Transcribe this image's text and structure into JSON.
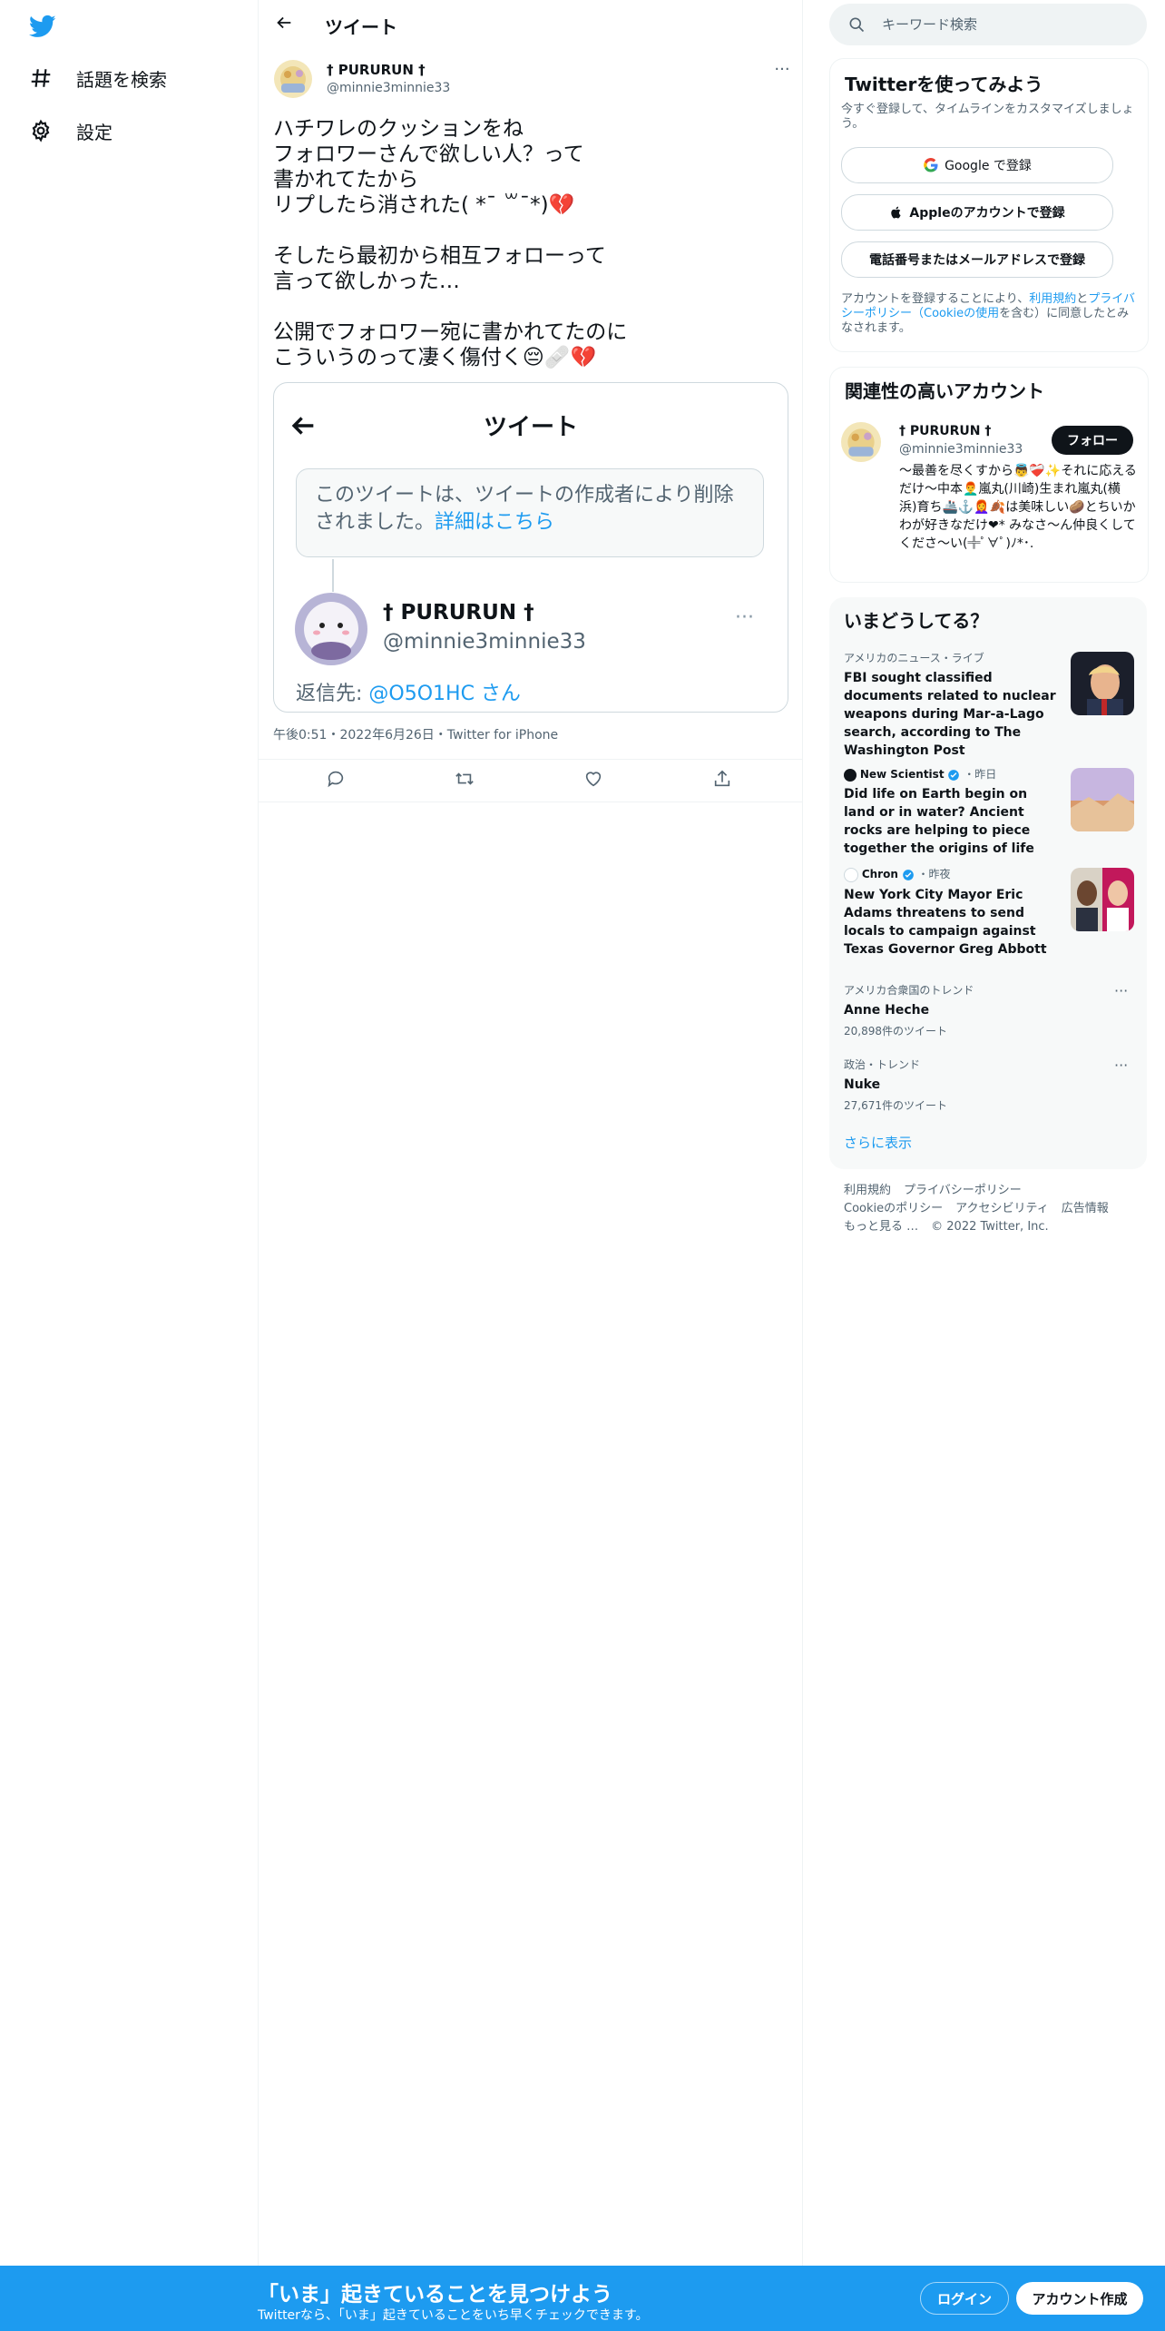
{
  "left_nav": {
    "logo": "twitter-bird-icon",
    "items": [
      {
        "label": "話題を検索",
        "icon": "hashtag-icon"
      },
      {
        "label": "設定",
        "icon": "gear-icon"
      }
    ]
  },
  "main": {
    "header_title": "ツイート",
    "tweet": {
      "author_name": "† PURURUN †",
      "author_handle": "@minnie3minnie33",
      "text": "ハチワレのクッションをね\nフォロワーさんで欲しい人？って\n書かれてたから\nリプしたら消された( *¯ ꒳¯*)💔\n\nそしたら最初から相互フォローって\n言って欲しかった…\n\n公開でフォロワー宛に書かれてたのに\nこういうのって凄く傷付く😔🩹💔",
      "meta": "午後0:51・2022年6月26日・Twitter for iPhone"
    },
    "embed": {
      "title": "ツイート",
      "deleted_text": "このツイートは、ツイートの作成者により削除されました。",
      "deleted_link": "詳細はこちら",
      "name": "† PURURUN †",
      "handle": "@minnie3minnie33",
      "more": "···",
      "reply_prefix": "返信先: ",
      "reply_to": "@O5O1HC さん"
    }
  },
  "right": {
    "search_placeholder": "キーワード検索",
    "signup": {
      "title": "Twitterを使ってみよう",
      "subtitle": "今すぐ登録して、タイムラインをカスタマイズしましょう。",
      "google": "Google で登録",
      "apple": "Appleのアカウントで登録",
      "phone": "電話番号またはメールアドレスで登録",
      "legal_pre": "アカウントを登録することにより、",
      "legal_tos": "利用規約",
      "legal_and": "と",
      "legal_privacy": "プライバシーポリシー（Cookieの使用",
      "legal_post": "を含む）に同意したとみなされます。"
    },
    "related": {
      "title": "関連性の高いアカウント",
      "name": "† PURURUN †",
      "handle": "@minnie3minnie33",
      "follow": "フォロー",
      "bio": "～最善を尽くすから👼❤️‍🩹✨それに応えるだけ～中本👨‍🦰嵐丸(川崎)生まれ嵐丸(横浜)育ち🚢⚓️👩‍🦰🍂は美味しい🥔とちいかわが好きなだけ❤︎* みなさ～ん仲良くしてくださ～い(╬ﾟ∀ﾟ)ﾉ*･."
    },
    "trends": {
      "title": "いまどうしてる？",
      "items": [
        {
          "context": "アメリカのニュース・ライブ",
          "title": "FBI sought classified documents related to nuclear weapons during Mar-a-Lago search, according to The Washington Post"
        },
        {
          "source": "New Scientist",
          "time": "・昨日",
          "title": "Did life on Earth begin on land or in water? Ancient rocks are helping to piece together the origins of life"
        },
        {
          "source": "Chron",
          "time": "・昨夜",
          "title": "New York City Mayor Eric Adams threatens to send locals to campaign against Texas Governor Greg Abbott"
        },
        {
          "context": "アメリカ合衆国のトレンド",
          "title": "Anne Heche",
          "count": "20,898件のツイート"
        },
        {
          "context": "政治・トレンド",
          "title": "Nuke",
          "count": "27,671件のツイート"
        }
      ],
      "show_more": "さらに表示"
    },
    "footer": {
      "terms": "利用規約",
      "privacy": "プライバシーポリシー",
      "cookie": "Cookieのポリシー",
      "accessibility": "アクセシビリティ",
      "ads": "広告情報",
      "more": "もっと見る …",
      "copyright": "© 2022 Twitter, Inc."
    }
  },
  "bottom_bar": {
    "title": "「いま」起きていることを見つけよう",
    "subtitle": "Twitterなら、「いま」起きていることをいち早くチェックできます。",
    "login": "ログイン",
    "signup": "アカウント作成"
  },
  "colors": {
    "accent": "#1d9bf0",
    "text": "#0f1419",
    "muted": "#536471"
  }
}
